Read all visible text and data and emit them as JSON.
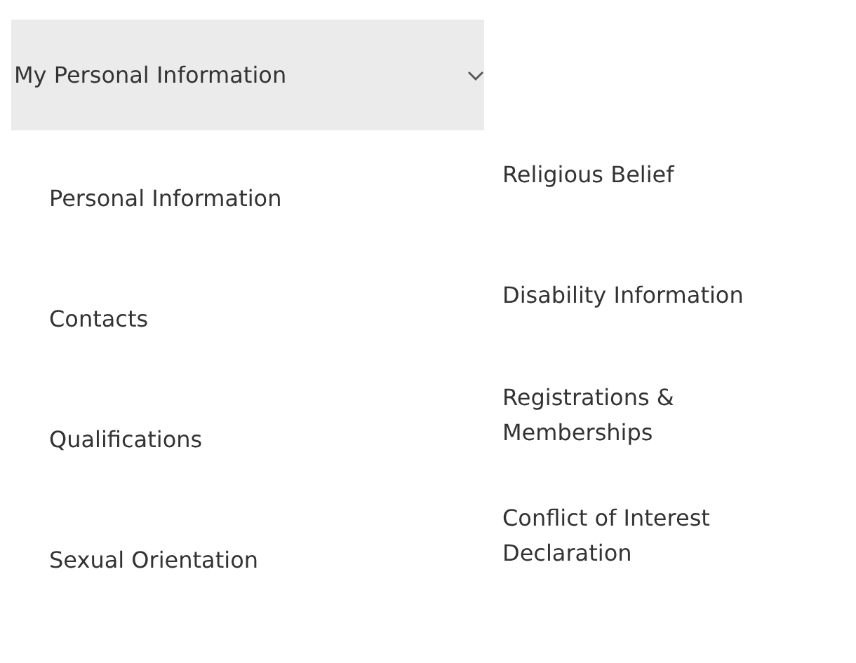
{
  "menu": {
    "title": "My Personal Information",
    "expanded": true,
    "columns": [
      {
        "items": [
          "Personal Information",
          "Contacts",
          "Qualifications",
          "Sexual Orientation"
        ]
      },
      {
        "items": [
          "Religious Belief",
          "Disability Information",
          "Registrations & Memberships",
          "Conflict of Interest Declaration"
        ]
      }
    ]
  }
}
